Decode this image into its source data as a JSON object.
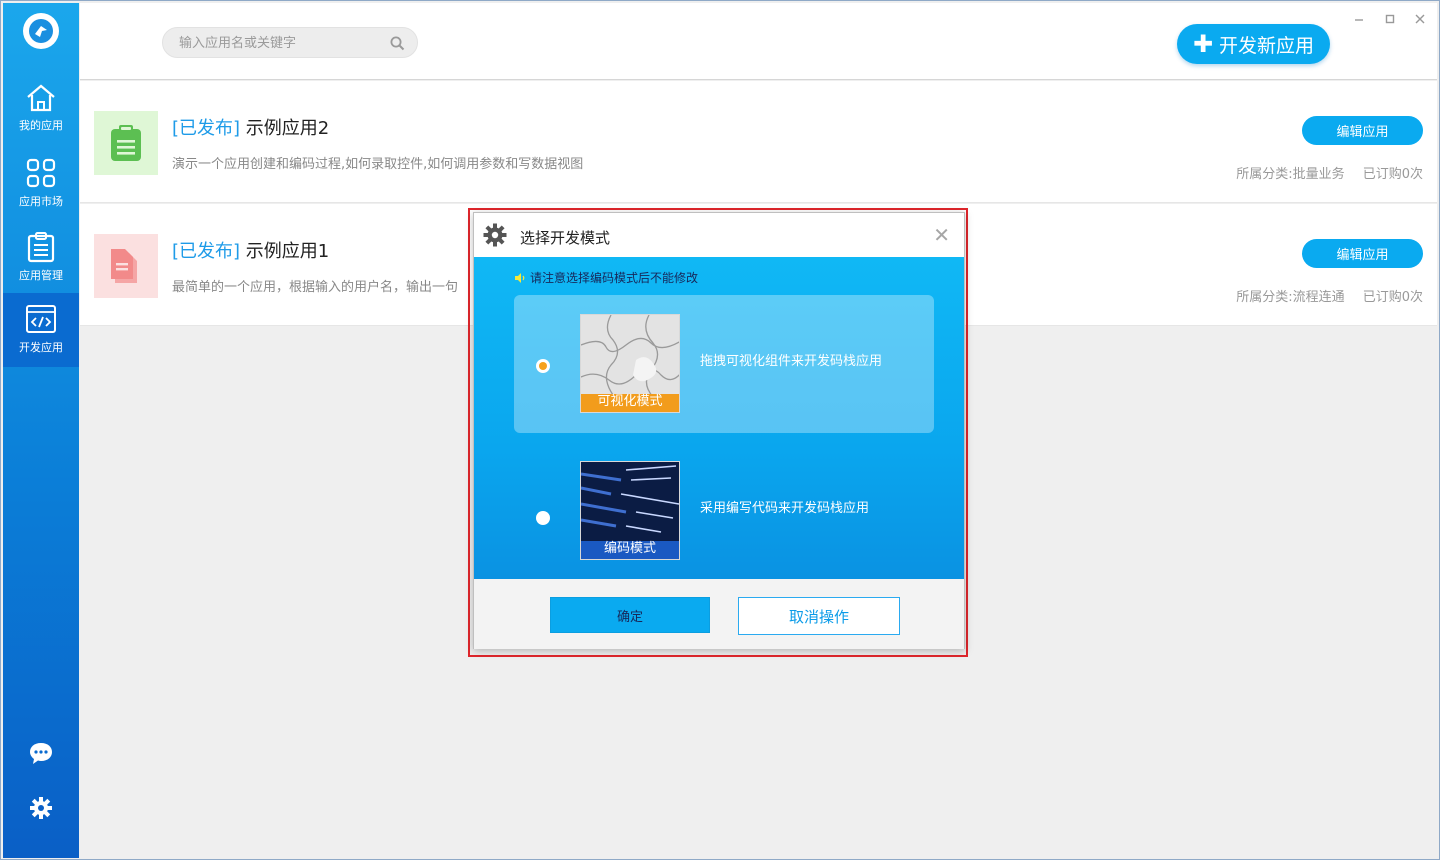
{
  "sidebar": {
    "items": [
      {
        "label": "我的应用",
        "icon": "home-icon"
      },
      {
        "label": "应用市场",
        "icon": "grid-icon"
      },
      {
        "label": "应用管理",
        "icon": "clipboard-icon"
      },
      {
        "label": "开发应用",
        "icon": "code-icon"
      }
    ],
    "bottom_icons": [
      "chat-icon",
      "gear-icon"
    ]
  },
  "header": {
    "search_placeholder": "输入应用名或关键字",
    "new_app_label": "开发新应用"
  },
  "apps": [
    {
      "status": "[已发布]",
      "name": "示例应用2",
      "description": "演示一个应用创建和编码过程,如何录取控件,如何调用参数和写数据视图",
      "edit_label": "编辑应用",
      "category": "所属分类:批量业务",
      "subscriptions": "已订购0次",
      "thumb_color": "#dff7d6",
      "icon_color": "#4caf50"
    },
    {
      "status": "[已发布]",
      "name": "示例应用1",
      "description": "最简单的一个应用，根据输入的用户名，输出一句",
      "edit_label": "编辑应用",
      "category": "所属分类:流程连通",
      "subscriptions": "已订购0次",
      "thumb_color": "#fbe0e0",
      "icon_color": "#f28a8a"
    }
  ],
  "dialog": {
    "title": "选择开发模式",
    "notice": "请注意选择编码模式后不能修改",
    "modes": [
      {
        "caption": "可视化模式",
        "description": "拖拽可视化组件来开发码栈应用",
        "selected": true
      },
      {
        "caption": "编码模式",
        "description": "采用编写代码来开发码栈应用",
        "selected": false
      }
    ],
    "confirm_label": "确定",
    "cancel_label": "取消操作"
  },
  "colors": {
    "accent": "#0aaaf0",
    "sidebar_top": "#1ba7ec",
    "sidebar_bottom": "#0a5fc6",
    "dialog_highlight": "#e0262c",
    "radio_selected": "#f6a21e"
  }
}
